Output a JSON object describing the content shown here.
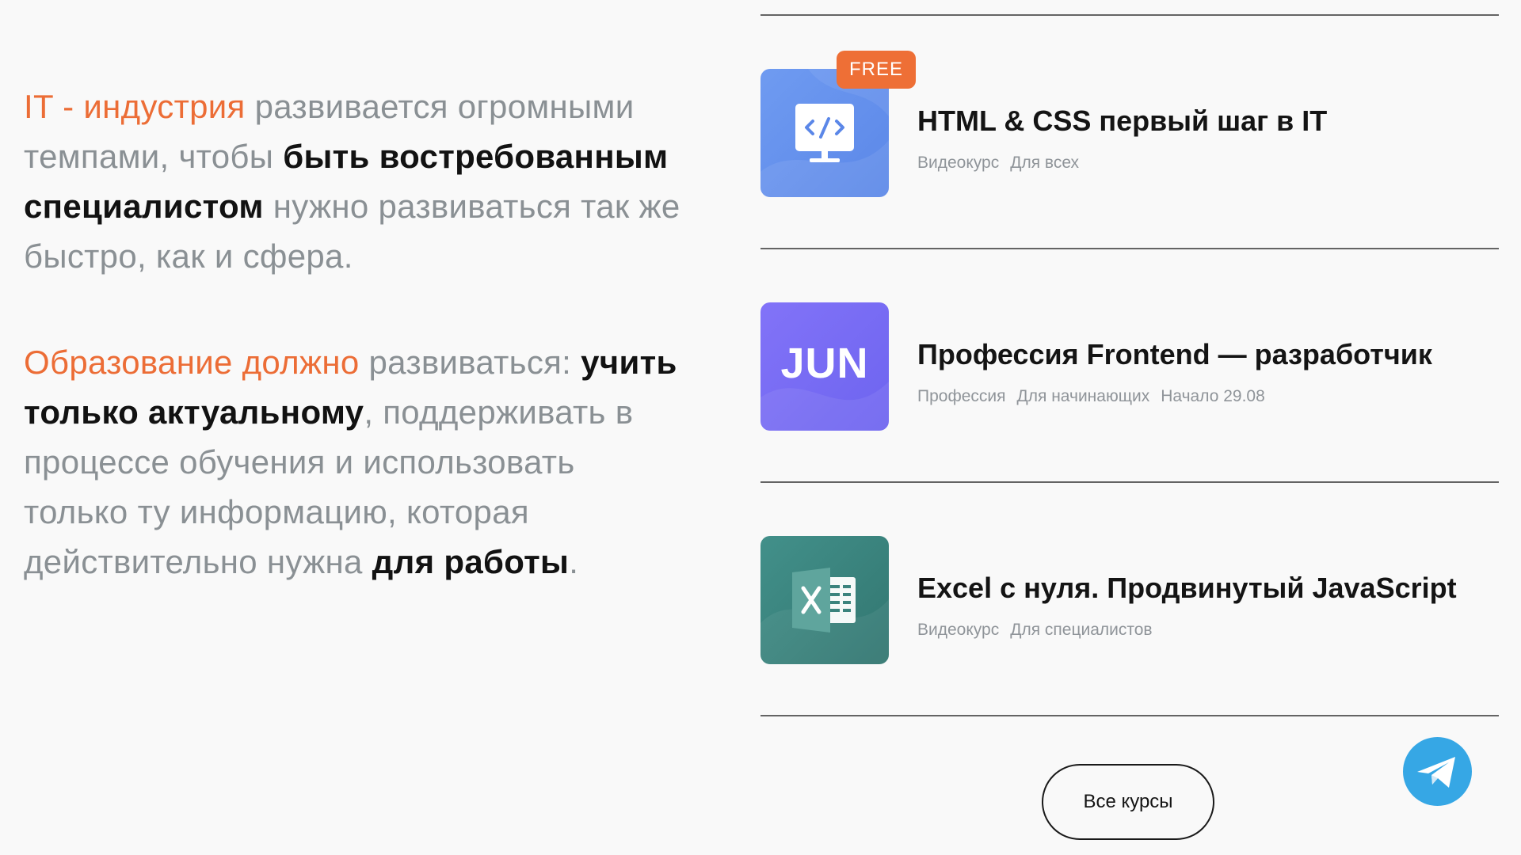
{
  "intro": {
    "p1": {
      "accent": "IT - индустрия",
      "t1": " развивается огромными темпами, чтобы ",
      "strong": "быть востребованным специалистом",
      "t2": " нужно развиваться так же быстро, как и сфера."
    },
    "p2": {
      "accent": "Образование должно",
      "t1": " развиваться: ",
      "strong1": "учить только актуальному",
      "t2": ", поддерживать в процессе обучения и использовать только ту информацию, которая действительно нужна ",
      "strong2": "для работы",
      "t3": "."
    }
  },
  "courses": [
    {
      "title": "HTML & CSS первый шаг в IT",
      "tags": [
        "Видеокурс",
        "Для всех"
      ],
      "badge": "FREE",
      "icon": "monitor-code-icon",
      "color": "#6a95ef"
    },
    {
      "title": "Профессия Frontend — разработчик",
      "tags": [
        "Профессия",
        "Для начинающих",
        "Начало 29.08"
      ],
      "thumb_text": "JUN",
      "color": "#7a6cf5"
    },
    {
      "title": "Excel с нуля. Продвинутый JavaScript",
      "tags": [
        "Видеокурс",
        "Для специалистов"
      ],
      "icon": "excel-icon",
      "color": "#3a837d"
    }
  ],
  "all_courses_label": "Все курсы",
  "telegram": {
    "icon": "telegram-icon",
    "color": "#36a7e5"
  },
  "colors": {
    "accent": "#ec6d36",
    "muted": "#8a9094",
    "strong": "#121212"
  }
}
